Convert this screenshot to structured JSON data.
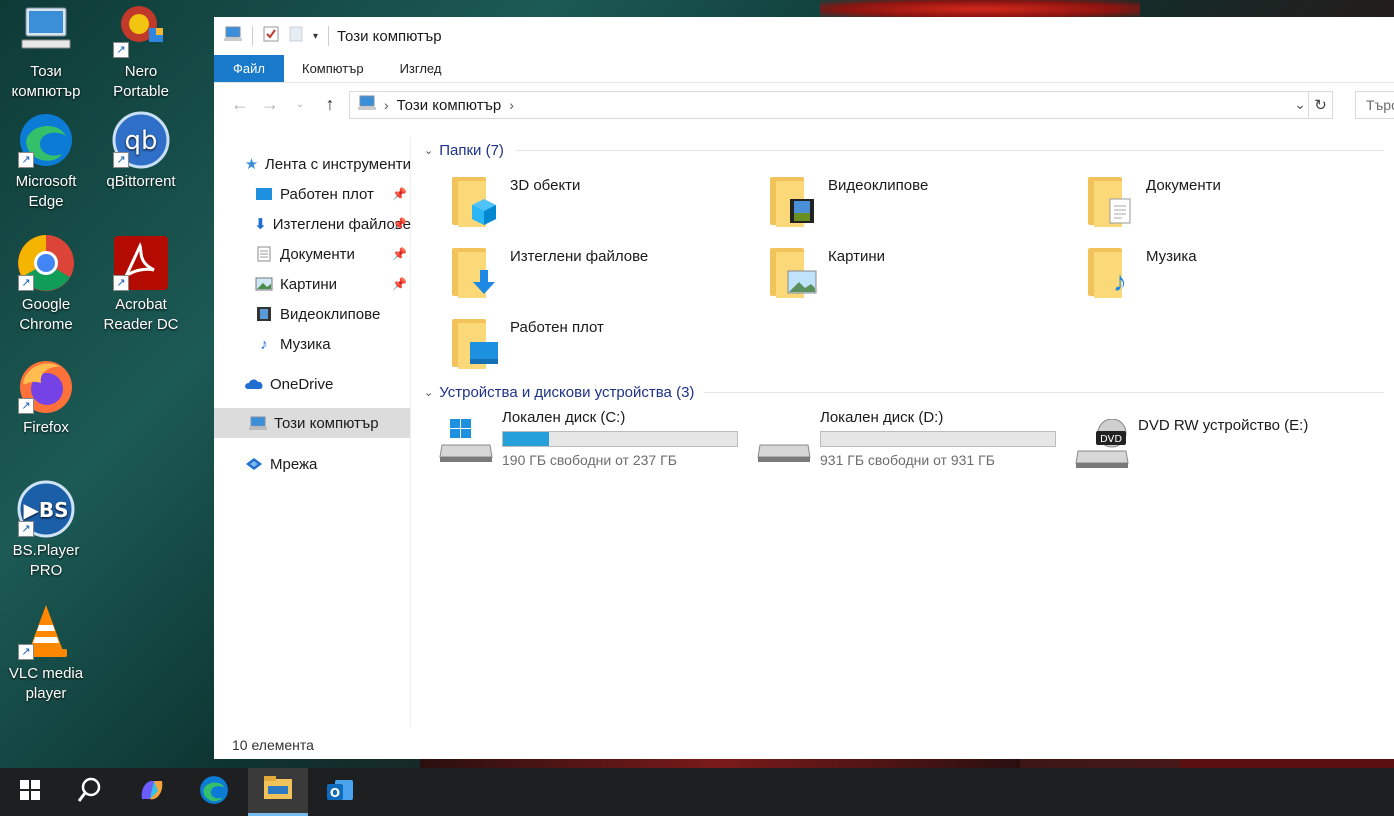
{
  "desktop": {
    "icons": [
      {
        "label_1": "Този",
        "label_2": "компютър",
        "icon": "this-pc-icon"
      },
      {
        "label_1": "Nero",
        "label_2": "Portable",
        "icon": "nero-icon"
      },
      {
        "label_1": "Microsoft",
        "label_2": "Edge",
        "icon": "edge-icon"
      },
      {
        "label_1": "qBittorrent",
        "label_2": "",
        "icon": "qbittorrent-icon"
      },
      {
        "label_1": "Google",
        "label_2": "Chrome",
        "icon": "chrome-icon"
      },
      {
        "label_1": "Acrobat",
        "label_2": "Reader DC",
        "icon": "acrobat-icon"
      },
      {
        "label_1": "Firefox",
        "label_2": "",
        "icon": "firefox-icon"
      },
      {
        "label_1": "BS.Player",
        "label_2": "PRO",
        "icon": "bsplayer-icon"
      },
      {
        "label_1": "VLC media",
        "label_2": "player",
        "icon": "vlc-icon"
      }
    ]
  },
  "window": {
    "title": "Този компютър",
    "ribbon_tabs": [
      "Файл",
      "Компютър",
      "Изглед"
    ],
    "address": {
      "crumb": "Този компютър",
      "search_placeholder": "Търс"
    },
    "nav": [
      {
        "label": "Лента с инструменти",
        "icon": "star-icon",
        "pinned": false
      },
      {
        "label": "Работен плот",
        "icon": "desktop-icon",
        "pinned": true
      },
      {
        "label": "Изтеглени файлове",
        "icon": "download-icon",
        "pinned": true
      },
      {
        "label": "Документи",
        "icon": "document-icon",
        "pinned": true
      },
      {
        "label": "Картини",
        "icon": "pictures-icon",
        "pinned": true
      },
      {
        "label": "Видеоклипове",
        "icon": "video-icon",
        "pinned": false
      },
      {
        "label": "Музика",
        "icon": "music-icon",
        "pinned": false
      },
      {
        "label": "OneDrive",
        "icon": "cloud-icon",
        "pinned": false
      },
      {
        "label": "Този компютър",
        "icon": "pc-icon",
        "pinned": false
      },
      {
        "label": "Мрежа",
        "icon": "network-icon",
        "pinned": false
      }
    ],
    "folders_header": "Папки (7)",
    "folders": [
      {
        "name": "3D обекти",
        "icon": "3d-objects-icon"
      },
      {
        "name": "Видеоклипове",
        "icon": "videos-icon"
      },
      {
        "name": "Документи",
        "icon": "documents-icon"
      },
      {
        "name": "Изтеглени файлове",
        "icon": "downloads-icon"
      },
      {
        "name": "Картини",
        "icon": "pictures-icon"
      },
      {
        "name": "Музика",
        "icon": "music-icon"
      },
      {
        "name": "Работен плот",
        "icon": "desktop-icon"
      }
    ],
    "devices_header": "Устройства и дискови устройства (3)",
    "drives": [
      {
        "name": "Локален диск (C:)",
        "free": "190 ГБ свободни от 237 ГБ",
        "used_fraction": 0.198
      },
      {
        "name": "Локален диск (D:)",
        "free": "931 ГБ свободни от 931 ГБ",
        "used_fraction": 0.0
      },
      {
        "name": "DVD RW устройство (E:)",
        "free": "",
        "used_fraction": null
      }
    ],
    "status": "10 елемента"
  },
  "taskbar": {
    "items": [
      "start-icon",
      "search-icon",
      "copilot-icon",
      "edge-icon",
      "file-explorer-icon",
      "outlook-icon"
    ],
    "active": "file-explorer-icon"
  },
  "colors": {
    "accent": "#1979ca",
    "drive_fill": "#26a0da",
    "group_header": "#1e3287"
  }
}
